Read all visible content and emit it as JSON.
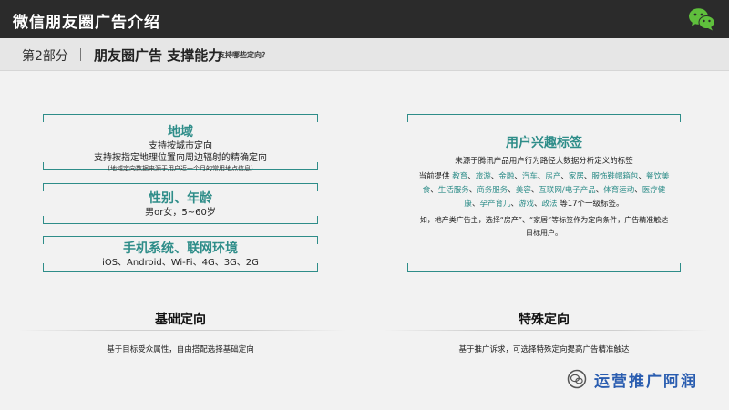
{
  "header": {
    "title": "微信朋友圈广告介绍",
    "logo_icon": "wechat-logo-icon"
  },
  "subheader": {
    "part": "第2部分",
    "section": "朋友圈广告 支撑能力",
    "question": "支持哪些定向？"
  },
  "basic": {
    "region": {
      "title": "地域",
      "line1": "支持按城市定向",
      "line2": "支持按指定地理位置向周边辐射的精确定向",
      "note": "(地域定向数据来源于用户近一个月的常用地点信息)"
    },
    "gender_age": {
      "title": "性别、年龄",
      "line1": "男or女，5~60岁"
    },
    "device": {
      "title": "手机系统、联网环境",
      "line1": "iOS、Android、Wi-Fi、4G、3G、2G"
    },
    "heading": "基础定向",
    "caption": "基于目标受众属性，自由搭配选择基础定向"
  },
  "special": {
    "title": "用户兴趣标签",
    "intro": "来源于腾讯产品用户行为路径大数据分析定义的标签",
    "list_prefix": "当前提供 ",
    "tags": [
      "教育",
      "旅游",
      "金融",
      "汽车",
      "房产",
      "家居",
      "服饰鞋帽箱包",
      "餐饮美食",
      "生活服务",
      "商务服务",
      "美容",
      "互联网/电子产品",
      "体育运动",
      "医疗健康",
      "孕产育儿",
      "游戏",
      "政法"
    ],
    "list_suffix": " 等17个一级标签。",
    "note": "如，地产类广告主，选择“房产”、“家居”等标签作为定向条件，广告精准触达目标用户。",
    "heading": "特殊定向",
    "caption": "基于推广诉求，可选择特殊定向提高广告精准触达"
  },
  "watermark": {
    "icon": "wechat-official-account-icon",
    "text": "运营推广阿润"
  },
  "colors": {
    "accent": "#2e8d89",
    "topbar": "#2b2b2b",
    "watermark": "#2a5db0"
  }
}
